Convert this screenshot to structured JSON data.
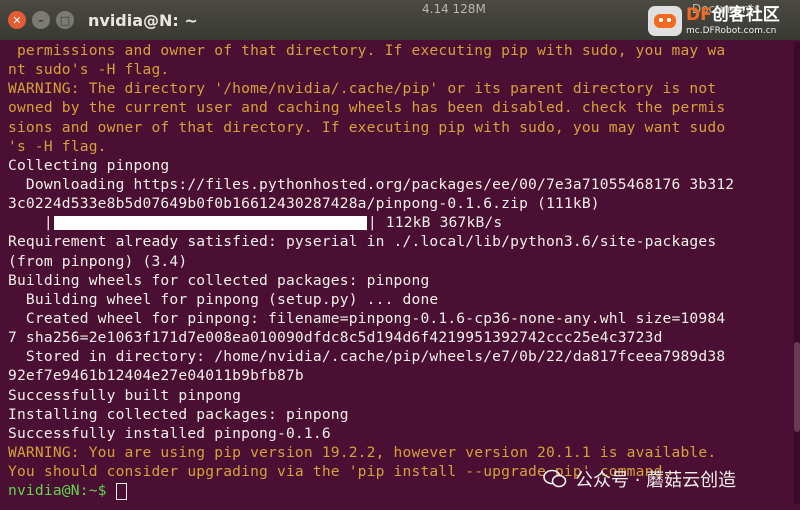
{
  "window": {
    "title": "nvidia@N: ~"
  },
  "background": {
    "stat": "4.14  128M",
    "docs": "Documents"
  },
  "logo": {
    "df": "DF",
    "brand": "创客社区",
    "sub": "mc.DFRobot.com.cn"
  },
  "terminal": {
    "lines": [
      {
        "cls": "y",
        "text": " permissions and owner of that directory. If executing pip with sudo, you may wa"
      },
      {
        "cls": "y",
        "text": "nt sudo's -H flag."
      },
      {
        "cls": "y",
        "text": "WARNING: The directory '/home/nvidia/.cache/pip' or its parent directory is not"
      },
      {
        "cls": "y",
        "text": "owned by the current user and caching wheels has been disabled. check the permis"
      },
      {
        "cls": "y",
        "text": "sions and owner of that directory. If executing pip with sudo, you may want sudo"
      },
      {
        "cls": "y",
        "text": "'s -H flag."
      },
      {
        "cls": "w",
        "text": "Collecting pinpong"
      },
      {
        "cls": "w",
        "text": "  Downloading https://files.pythonhosted.org/packages/ee/00/7e3a71055468176 3b312"
      },
      {
        "cls": "w",
        "text": "3c0224d533e8b5d07649b0f0b16612430287428a/pinpong-0.1.6.zip (111kB)"
      },
      {
        "cls": "progress",
        "prefix": "    |",
        "suffix": "| 112kB 367kB/s",
        "progress_fraction": 1.0
      },
      {
        "cls": "w",
        "text": "Requirement already satisfied: pyserial in ./.local/lib/python3.6/site-packages"
      },
      {
        "cls": "w",
        "text": "(from pinpong) (3.4)"
      },
      {
        "cls": "w",
        "text": "Building wheels for collected packages: pinpong"
      },
      {
        "cls": "w",
        "text": "  Building wheel for pinpong (setup.py) ... done"
      },
      {
        "cls": "w",
        "text": "  Created wheel for pinpong: filename=pinpong-0.1.6-cp36-none-any.whl size=10984"
      },
      {
        "cls": "w",
        "text": "7 sha256=2e1063f171d7e008ea010090dfdc8c5d194d6f4219951392742ccc25e4c3723d"
      },
      {
        "cls": "w",
        "text": "  Stored in directory: /home/nvidia/.cache/pip/wheels/e7/0b/22/da817fceea7989d38"
      },
      {
        "cls": "w",
        "text": "92ef7e9461b12404e27e04011b9bfb87b"
      },
      {
        "cls": "w",
        "text": "Successfully built pinpong"
      },
      {
        "cls": "w",
        "text": "Installing collected packages: pinpong"
      },
      {
        "cls": "w",
        "text": "Successfully installed pinpong-0.1.6"
      },
      {
        "cls": "y",
        "text": "WARNING: You are using pip version 19.2.2, however version 20.1.1 is available."
      },
      {
        "cls": "y",
        "text": "You should consider upgrading via the 'pip install --upgrade pip' command."
      },
      {
        "cls": "prompt",
        "prompt": "nvidia@N:~$ "
      }
    ]
  },
  "watermark": {
    "text": "公众号 · 蘑菇云创造"
  },
  "colors": {
    "terminal_bg": "#4a0f33",
    "warning": "#d6a13a",
    "text": "#f2efe8",
    "prompt": "#5fd74a",
    "logo_accent": "#f26a21"
  }
}
